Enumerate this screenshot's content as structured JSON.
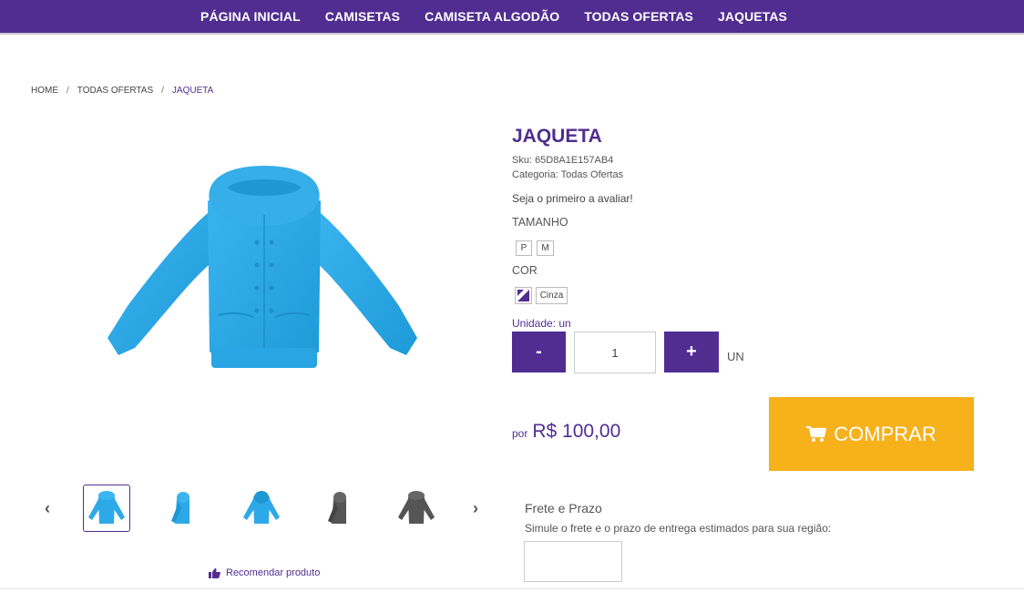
{
  "nav": {
    "items": [
      {
        "label": "PÁGINA INICIAL"
      },
      {
        "label": "CAMISETAS"
      },
      {
        "label": "CAMISETA ALGODÃO"
      },
      {
        "label": "TODAS OFERTAS"
      },
      {
        "label": "JAQUETAS"
      }
    ]
  },
  "breadcrumb": {
    "home": "HOME",
    "sep": "/",
    "category": "TODAS OFERTAS",
    "current": "JAQUETA"
  },
  "gallery": {
    "thumbnails": [
      {
        "color": "#2ea9e8",
        "view": "front"
      },
      {
        "color": "#2ea9e8",
        "view": "side"
      },
      {
        "color": "#2ea9e8",
        "view": "back"
      },
      {
        "color": "#555555",
        "view": "side"
      },
      {
        "color": "#555555",
        "view": "front"
      }
    ],
    "prev_icon": "chevron-left-icon",
    "next_icon": "chevron-right-icon"
  },
  "recommend": {
    "icon": "thumbs-up-icon",
    "label": "Recomendar produto"
  },
  "product": {
    "title": "JAQUETA",
    "sku": "Sku: 65D8A1E157AB4",
    "category": "Categoria: Todas Ofertas",
    "rating_text": "Seja o primeiro a avaliar!",
    "size_label": "TAMANHO",
    "sizes": [
      "P",
      "M"
    ],
    "color_label": "COR",
    "color_name": "Cinza",
    "unit_label": "Unidade: un",
    "qty_minus": "-",
    "qty_plus": "+",
    "qty_value": "1",
    "unit_suffix": "UN",
    "price_prefix": "por",
    "price": "R$ 100,00",
    "buy_label": "COMPRAR",
    "buy_icon": "cart-icon"
  },
  "shipping": {
    "title": "Frete e Prazo",
    "description": "Simule o frete e o prazo de entrega estimados para sua região:",
    "cep_value": ""
  },
  "colors": {
    "brand": "#512d91",
    "buy": "#f7b11b",
    "jacket_blue": "#2ea9e8",
    "jacket_gray": "#555555"
  }
}
